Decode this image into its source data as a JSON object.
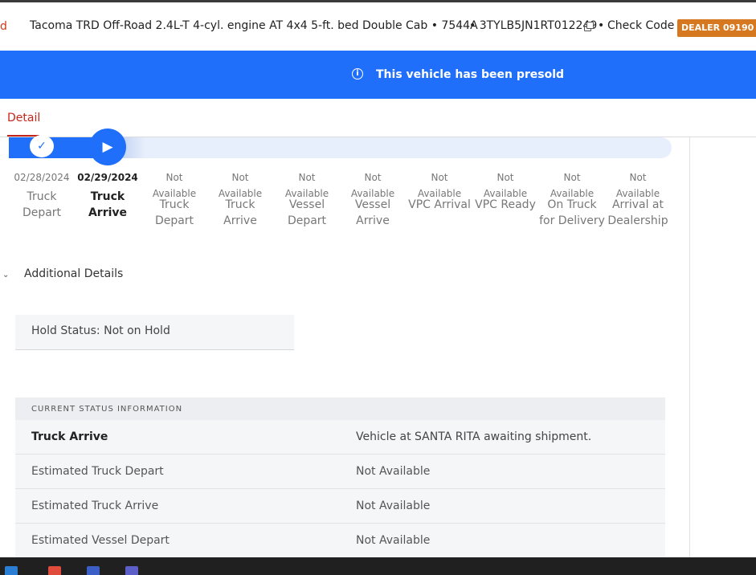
{
  "header": {
    "cut_char": "d",
    "title": "Tacoma TRD Off-Road 2.4L-T 4-cyl. engine AT 4x4 5-ft. bed Double Cab • 7544A",
    "vin": "• 3TYLB5JN1RT012249",
    "separator": "•",
    "check_code": "Check Code",
    "dealer_badge": "DEALER 09190"
  },
  "banner": {
    "message": "This vehicle has been presold",
    "icon": "info-icon"
  },
  "tabs": {
    "active": "Detail"
  },
  "milestones": [
    {
      "date_line1": "02/28/2024",
      "date_line2": "",
      "name": "Truck Depart",
      "state": "done"
    },
    {
      "date_line1": "02/29/2024",
      "date_line2": "",
      "name": "Truck Arrive",
      "state": "current"
    },
    {
      "date_line1": "Not",
      "date_line2": "Available",
      "name": "Truck Depart",
      "state": "pending"
    },
    {
      "date_line1": "Not",
      "date_line2": "Available",
      "name": "Truck Arrive",
      "state": "pending"
    },
    {
      "date_line1": "Not",
      "date_line2": "Available",
      "name": "Vessel Depart",
      "state": "pending"
    },
    {
      "date_line1": "Not",
      "date_line2": "Available",
      "name": "Vessel Arrive",
      "state": "pending"
    },
    {
      "date_line1": "Not",
      "date_line2": "Available",
      "name": "VPC Arrival",
      "state": "pending"
    },
    {
      "date_line1": "Not",
      "date_line2": "Available",
      "name": "VPC Ready",
      "state": "pending"
    },
    {
      "date_line1": "Not",
      "date_line2": "Available",
      "name": "On Truck for Delivery",
      "state": "pending"
    },
    {
      "date_line1": "Not",
      "date_line2": "Available",
      "name": "Arrival at Dealership",
      "state": "pending"
    }
  ],
  "additional": {
    "label": "Additional Details"
  },
  "hold": {
    "text": "Hold Status: Not on Hold"
  },
  "status": {
    "heading": "CURRENT STATUS INFORMATION",
    "rows": [
      {
        "key": "Truck Arrive",
        "value": "Vehicle at SANTA RITA awaiting shipment."
      },
      {
        "key": "Estimated Truck Depart",
        "value": "Not Available"
      },
      {
        "key": "Estimated Truck Arrive",
        "value": "Not Available"
      },
      {
        "key": "Estimated Vessel Depart",
        "value": "Not Available"
      }
    ]
  },
  "colors": {
    "brand_blue": "#1f6ffa",
    "accent_red": "#c4251a",
    "badge_orange": "#d5781f"
  }
}
